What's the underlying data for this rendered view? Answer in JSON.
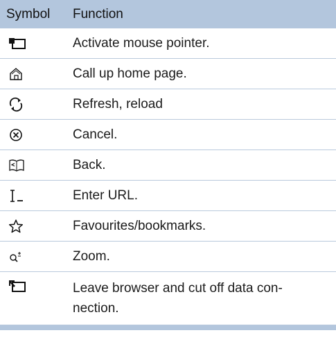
{
  "header": {
    "symbol": "Symbol",
    "function": "Function"
  },
  "rows": [
    {
      "icon": "mouse-pointer-icon",
      "function": "Activate mouse pointer."
    },
    {
      "icon": "home-icon",
      "function": "Call up home page."
    },
    {
      "icon": "refresh-icon",
      "function": "Refresh, reload"
    },
    {
      "icon": "cancel-icon",
      "function": "Cancel."
    },
    {
      "icon": "back-book-icon",
      "function": "Back."
    },
    {
      "icon": "enter-url-icon",
      "function": "Enter URL."
    },
    {
      "icon": "star-icon",
      "function": "Favourites/bookmarks."
    },
    {
      "icon": "zoom-icon",
      "function": "Zoom."
    },
    {
      "icon": "leave-browser-icon",
      "function": "Leave browser and cut off data con-",
      "function_line2": "nection."
    }
  ],
  "colors": {
    "header_bg": "#b3c6dd",
    "row_divider": "#b9c9dc"
  }
}
